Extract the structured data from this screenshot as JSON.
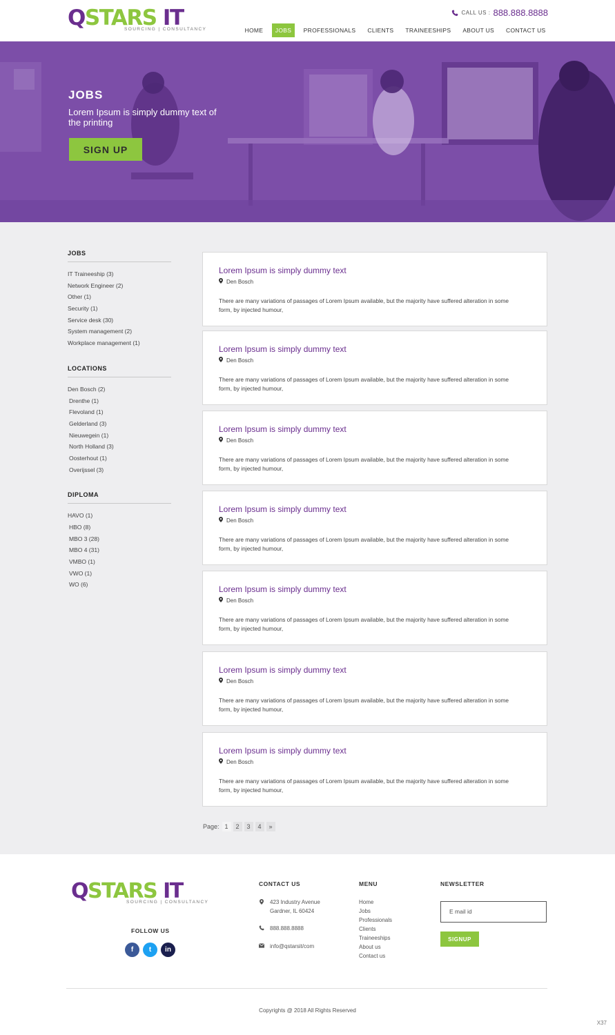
{
  "header": {
    "logo_q": "Q",
    "logo_stars": "STARS",
    "logo_it": " IT",
    "logo_tagline": "SOURCING | CONSULTANCY",
    "call_label": "CALL US :",
    "call_number": "888.888.8888",
    "nav": [
      {
        "label": "HOME",
        "active": false
      },
      {
        "label": "JOBS",
        "active": true
      },
      {
        "label": "PROFESSIONALS",
        "active": false
      },
      {
        "label": "CLIENTS",
        "active": false
      },
      {
        "label": "TRAINEESHIPS",
        "active": false
      },
      {
        "label": "ABOUT US",
        "active": false
      },
      {
        "label": "CONTACT US",
        "active": false
      }
    ]
  },
  "hero": {
    "title": "JOBS",
    "subtitle": "Lorem Ipsum is simply dummy text of the printing",
    "button": "SIGN UP"
  },
  "sidebar": {
    "jobs": {
      "heading": "JOBS",
      "items": [
        "IT Traineeship (3)",
        "Network Engineer (2)",
        "Other (1)",
        "Security (1)",
        "Service desk (30)",
        "System management (2)",
        "Workplace management (1)"
      ]
    },
    "locations": {
      "heading": "LOCATIONS",
      "items": [
        "Den Bosch (2)",
        "Drenthe (1)",
        "Flevoland (1)",
        "Gelderland (3)",
        "Nieuwegein (1)",
        "North Holland (3)",
        "Oosterhout (1)",
        "Overijssel (3)"
      ]
    },
    "diploma": {
      "heading": "DIPLOMA",
      "items": [
        "HAVO (1)",
        "HBO (8)",
        "MBO 3 (28)",
        "MBO 4 (31)",
        "VMBO (1)",
        "VWO (1)",
        "WO (6)"
      ]
    }
  },
  "jobs": [
    {
      "title": "Lorem Ipsum is simply dummy text",
      "location": "Den Bosch",
      "description": "There are many variations of passages of Lorem Ipsum available, but the majority have suffered alteration in some form, by injected humour,"
    },
    {
      "title": "Lorem Ipsum is simply dummy text",
      "location": "Den Bosch",
      "description": "There are many variations of passages of Lorem Ipsum available, but the majority have suffered alteration in some form, by injected humour,"
    },
    {
      "title": "Lorem Ipsum is simply dummy text",
      "location": "Den Bosch",
      "description": "There are many variations of passages of Lorem Ipsum available, but the majority have suffered alteration in some form, by injected humour,"
    },
    {
      "title": "Lorem Ipsum is simply dummy text",
      "location": "Den Bosch",
      "description": "There are many variations of passages of Lorem Ipsum available, but the majority have suffered alteration in some form, by injected humour,"
    },
    {
      "title": "Lorem Ipsum is simply dummy text",
      "location": "Den Bosch",
      "description": "There are many variations of passages of Lorem Ipsum available, but the majority have suffered alteration in some form, by injected humour,"
    },
    {
      "title": "Lorem Ipsum is simply dummy text",
      "location": "Den Bosch",
      "description": "There are many variations of passages of Lorem Ipsum available, but the majority have suffered alteration in some form, by injected humour,"
    },
    {
      "title": "Lorem Ipsum is simply dummy text",
      "location": "Den Bosch",
      "description": "There are many variations of passages of Lorem Ipsum available, but the majority have suffered alteration in some form, by injected humour,"
    }
  ],
  "pagination": {
    "label": "Page:",
    "pages": [
      "1",
      "2",
      "3",
      "4",
      "»"
    ],
    "current": "1"
  },
  "footer": {
    "logo_q": "Q",
    "logo_stars": "STARS",
    "logo_it": " IT",
    "logo_tagline": "SOURCING | CONSULTANCY",
    "follow_us": "FOLLOW US",
    "social": [
      {
        "icon": "facebook-icon",
        "glyph": "f",
        "color": "#3b5998"
      },
      {
        "icon": "twitter-icon",
        "glyph": "t",
        "color": "#1da1f2"
      },
      {
        "icon": "linkedin-icon",
        "glyph": "in",
        "color": "#1a1f4e"
      }
    ],
    "contact": {
      "heading": "CONTACT US",
      "address_line1": "423 Industry Avenue",
      "address_line2": "Gardner, IL 60424",
      "phone": "888.888.8888",
      "email": "info@qstarsit/com"
    },
    "menu": {
      "heading": "MENU",
      "items": [
        "Home",
        "Jobs",
        "Professionals",
        "Clients",
        "Traineeships",
        "About us",
        "Contact us"
      ]
    },
    "newsletter": {
      "heading": "NEWSLETTER",
      "placeholder": "E mail id",
      "button": "SIGNUP"
    },
    "copyright": "Copyrights @ 2018 All Rights Reserved",
    "corner_text": "X37"
  },
  "colors": {
    "brand_purple": "#6a2e8e",
    "brand_green": "#8dc63f",
    "hero_purple": "#7c4ea8"
  }
}
